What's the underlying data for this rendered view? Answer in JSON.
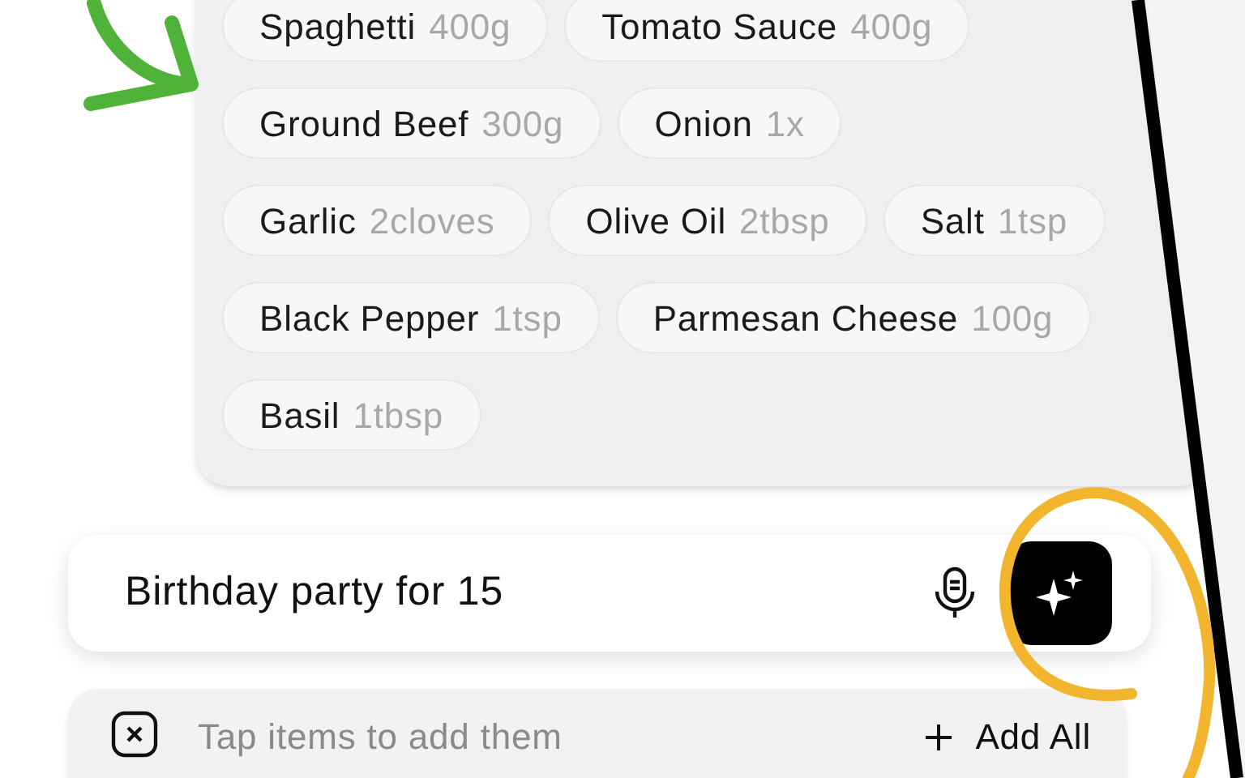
{
  "ingredient_rows": [
    [
      {
        "name": "Spaghetti",
        "amount": "400g"
      },
      {
        "name": "Tomato Sauce",
        "amount": "400g"
      }
    ],
    [
      {
        "name": "Ground Beef",
        "amount": "300g"
      },
      {
        "name": "Onion",
        "amount": "1x"
      }
    ],
    [
      {
        "name": "Garlic",
        "amount": "2cloves"
      },
      {
        "name": "Olive Oil",
        "amount": "2tbsp"
      },
      {
        "name": "Salt",
        "amount": "1tsp"
      }
    ],
    [
      {
        "name": "Black Pepper",
        "amount": "1tsp"
      },
      {
        "name": "Parmesan Cheese",
        "amount": "100g"
      }
    ],
    [
      {
        "name": "Basil",
        "amount": "1tbsp"
      }
    ]
  ],
  "prompt_field": {
    "value": "Birthday party for 15"
  },
  "footer": {
    "hint": "Tap items to add them",
    "add_all": "Add All"
  }
}
